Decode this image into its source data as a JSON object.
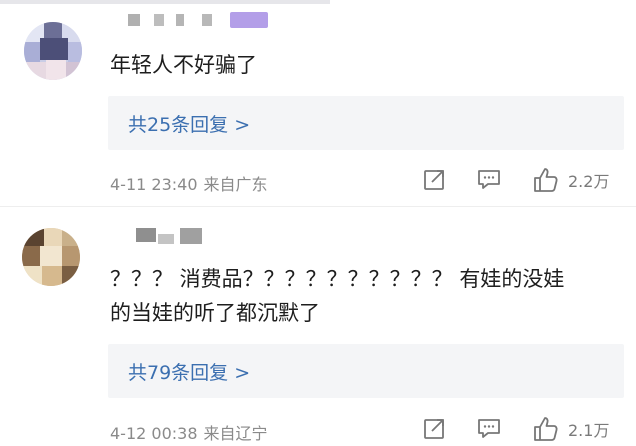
{
  "comments": [
    {
      "text": "年轻人不好骗了",
      "reply_label": "共25条回复 >",
      "time": "4-11 23:40",
      "location": "来自广东",
      "likes": "2.2万"
    },
    {
      "text_line1": "？？？ 消费品？？？？？？？？？？ 有娃的没娃",
      "text_line2": "的当娃的听了都沉默了",
      "reply_label": "共79条回复 >",
      "time": "4-12 00:38",
      "location": "来自辽宁",
      "likes": "2.1万"
    }
  ],
  "icons": {
    "share": "share-icon",
    "comment": "comment-icon",
    "like": "thumbs-up-icon"
  }
}
